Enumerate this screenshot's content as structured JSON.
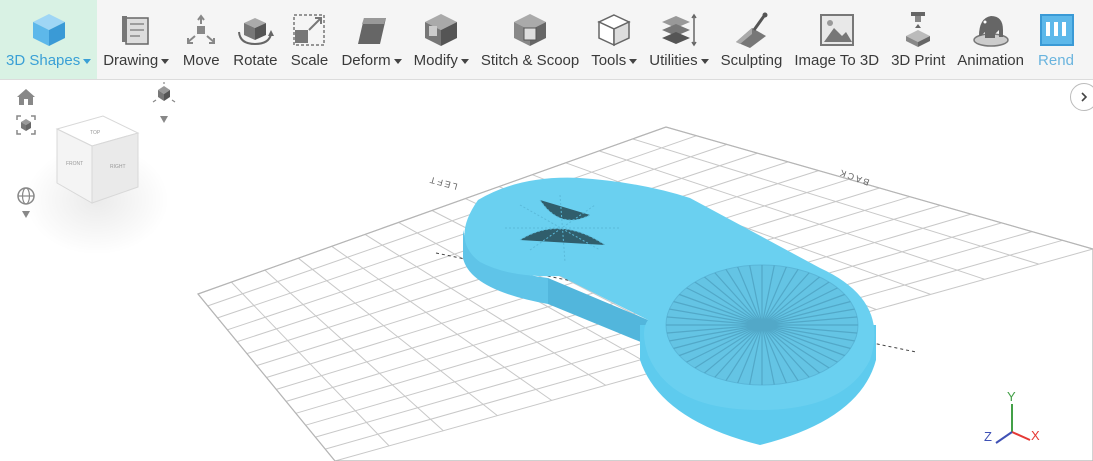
{
  "toolbar": {
    "items": [
      {
        "label": "3D Shapes",
        "icon": "cube-icon",
        "dropdown": true
      },
      {
        "label": "Drawing",
        "icon": "drawing-icon",
        "dropdown": true
      },
      {
        "label": "Move",
        "icon": "move-icon",
        "dropdown": false
      },
      {
        "label": "Rotate",
        "icon": "rotate-icon",
        "dropdown": false
      },
      {
        "label": "Scale",
        "icon": "scale-icon",
        "dropdown": false
      },
      {
        "label": "Deform",
        "icon": "deform-icon",
        "dropdown": true
      },
      {
        "label": "Modify",
        "icon": "modify-icon",
        "dropdown": true
      },
      {
        "label": "Stitch & Scoop",
        "icon": "stitch-scoop-icon",
        "dropdown": false
      },
      {
        "label": "Tools",
        "icon": "tools-icon",
        "dropdown": true
      },
      {
        "label": "Utilities",
        "icon": "utilities-icon",
        "dropdown": true
      },
      {
        "label": "Sculpting",
        "icon": "sculpting-icon",
        "dropdown": false
      },
      {
        "label": "Image To 3D",
        "icon": "image-to-3d-icon",
        "dropdown": false
      },
      {
        "label": "3D Print",
        "icon": "3d-print-icon",
        "dropdown": false
      },
      {
        "label": "Animation",
        "icon": "animation-icon",
        "dropdown": false
      },
      {
        "label": "Rend",
        "icon": "render-icon",
        "dropdown": false
      }
    ],
    "active_index": 0
  },
  "viewport": {
    "axis_labels": {
      "left": "LEFT",
      "back": "BACK"
    },
    "gizmo": {
      "x": "X",
      "y": "Y",
      "z": "Z"
    },
    "view_cube": {
      "top": "TOP",
      "front": "FRONT",
      "right": "RIGHT"
    }
  },
  "colors": {
    "accent": "#3aa0d6",
    "active_bg": "#d9f2e4",
    "model": "#6ad0f0",
    "grid": "#c8c8c8",
    "axis_x": "#e53935",
    "axis_y": "#43a047",
    "axis_z": "#3f51b5"
  }
}
